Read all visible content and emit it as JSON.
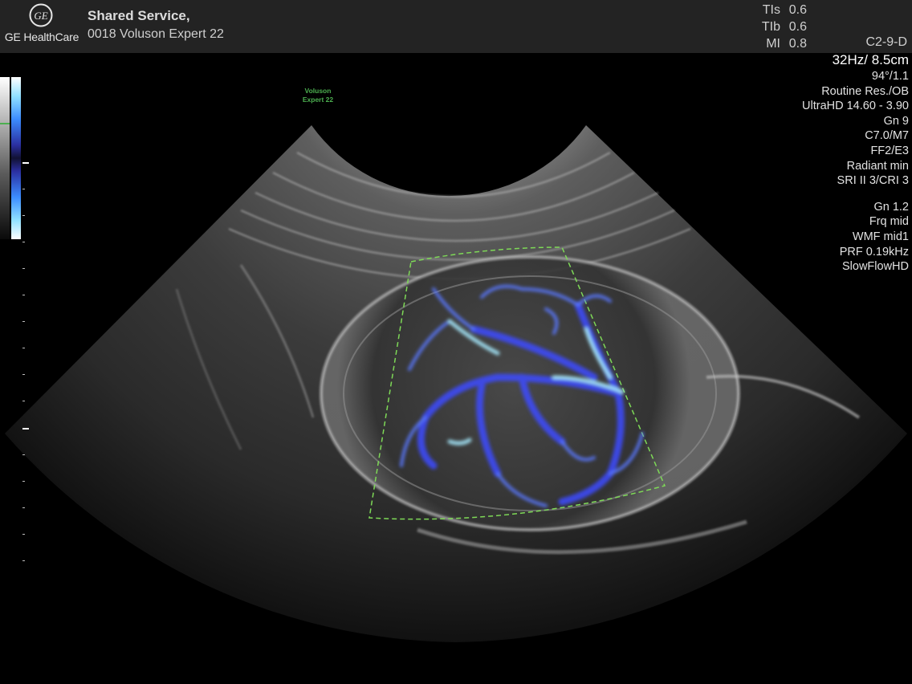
{
  "header": {
    "logo_text": "GE HealthCare",
    "patient_name": "Shared Service,",
    "device_name": "0018 Voluson Expert 22"
  },
  "safety": {
    "tis_label": "TIs",
    "tis_value": "0.6",
    "tib_label": "TIb",
    "tib_value": "0.6",
    "mi_label": "MI",
    "mi_value": "0.8"
  },
  "probe": "C2-9-D",
  "params": {
    "frame_depth": "32Hz/ 8.5cm",
    "angle": "94°/1.1",
    "preset": "Routine Res./OB",
    "ultrahd": "UltraHD 14.60 - 3.90",
    "gain": "Gn  9",
    "c_m": "C7.0/M7",
    "ff_e": "FF2/E3",
    "radiant": "Radiant min",
    "sri_cri": "SRI II 3/CRI 3",
    "color_gain": "Gn  1.2",
    "frequency": "Frq mid",
    "wmf": "WMF mid1",
    "prf": "PRF 0.19kHz",
    "flow_mode": "SlowFlowHD"
  },
  "watermark": {
    "line1": "Voluson",
    "line2": "Expert 22"
  },
  "colors": {
    "accent_green": "#4caf50",
    "flow_blue": "#3c5cff",
    "flow_cyan": "#8fe0ff"
  },
  "icons": {
    "logo": "ge-monogram-icon"
  }
}
